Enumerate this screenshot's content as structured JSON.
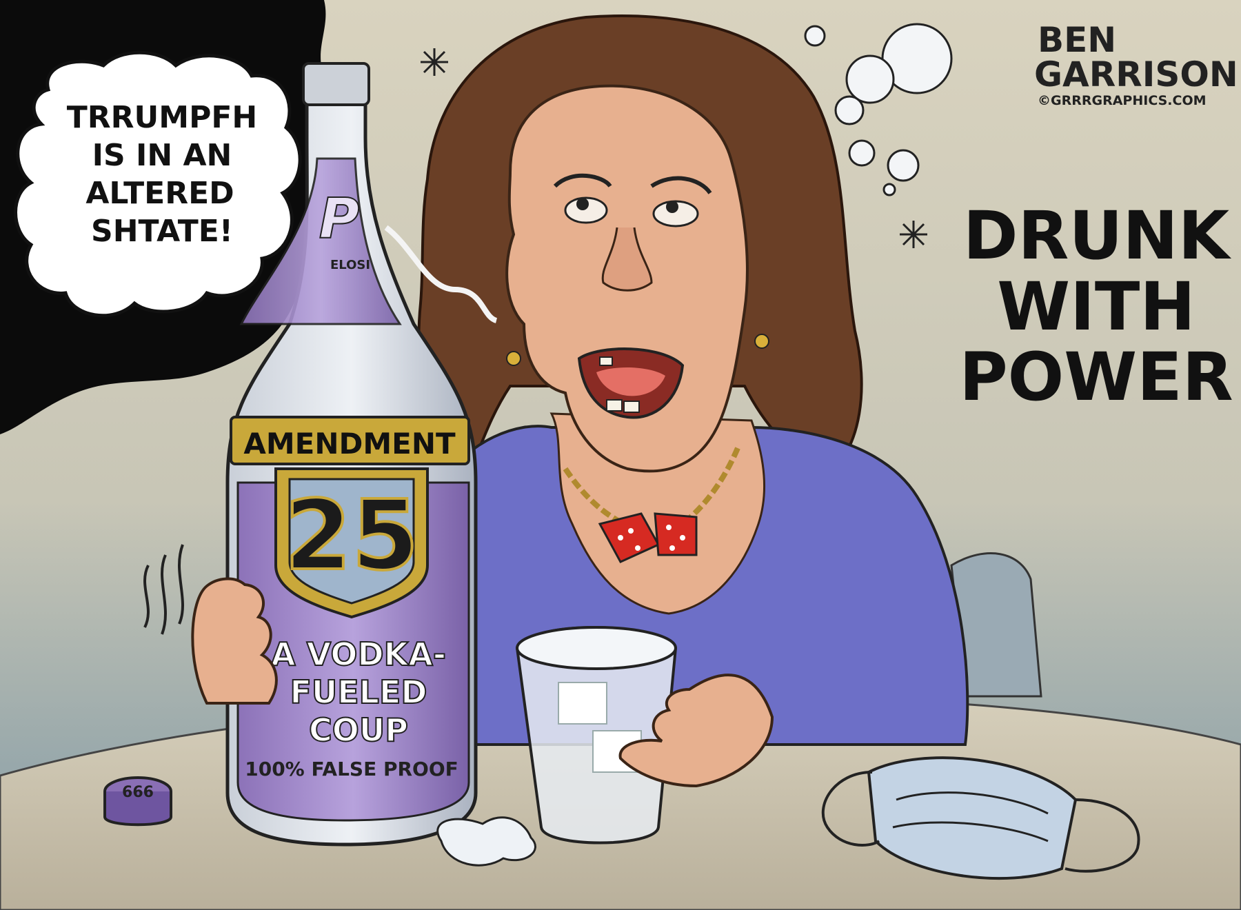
{
  "speech_bubble": {
    "lines": [
      "TRRUMPFH",
      "IS IN AN",
      "ALTERED",
      "SHTATE!"
    ]
  },
  "headline": {
    "lines": [
      "DRUNK",
      "WITH",
      "POWER"
    ]
  },
  "signature": {
    "line1": "BEN",
    "line2": "GARRISON",
    "copyright": "©GRRRGRAPHICS.COM"
  },
  "bottle": {
    "brand_letter": "P",
    "brand_name": "ELOSI",
    "label_title": "AMENDMENT",
    "label_number": "25",
    "tagline": [
      "A VODKA-",
      "FUELED",
      "COUP"
    ],
    "proof": "100% FALSE PROOF"
  },
  "bottle_cap": {
    "text": "666"
  },
  "colors": {
    "background_top": "#d8d2bd",
    "background_bottom": "#7f9aa6",
    "dark_cloud": "#0a0a0a",
    "bottle_purple": "#9a80c2",
    "label_gold": "#c9a83a",
    "dress_blue": "#6d6fc7",
    "hair_brown": "#6a3f26",
    "skin": "#e7b08f",
    "table": "#c9c1ad",
    "dice_red": "#d62a22"
  }
}
